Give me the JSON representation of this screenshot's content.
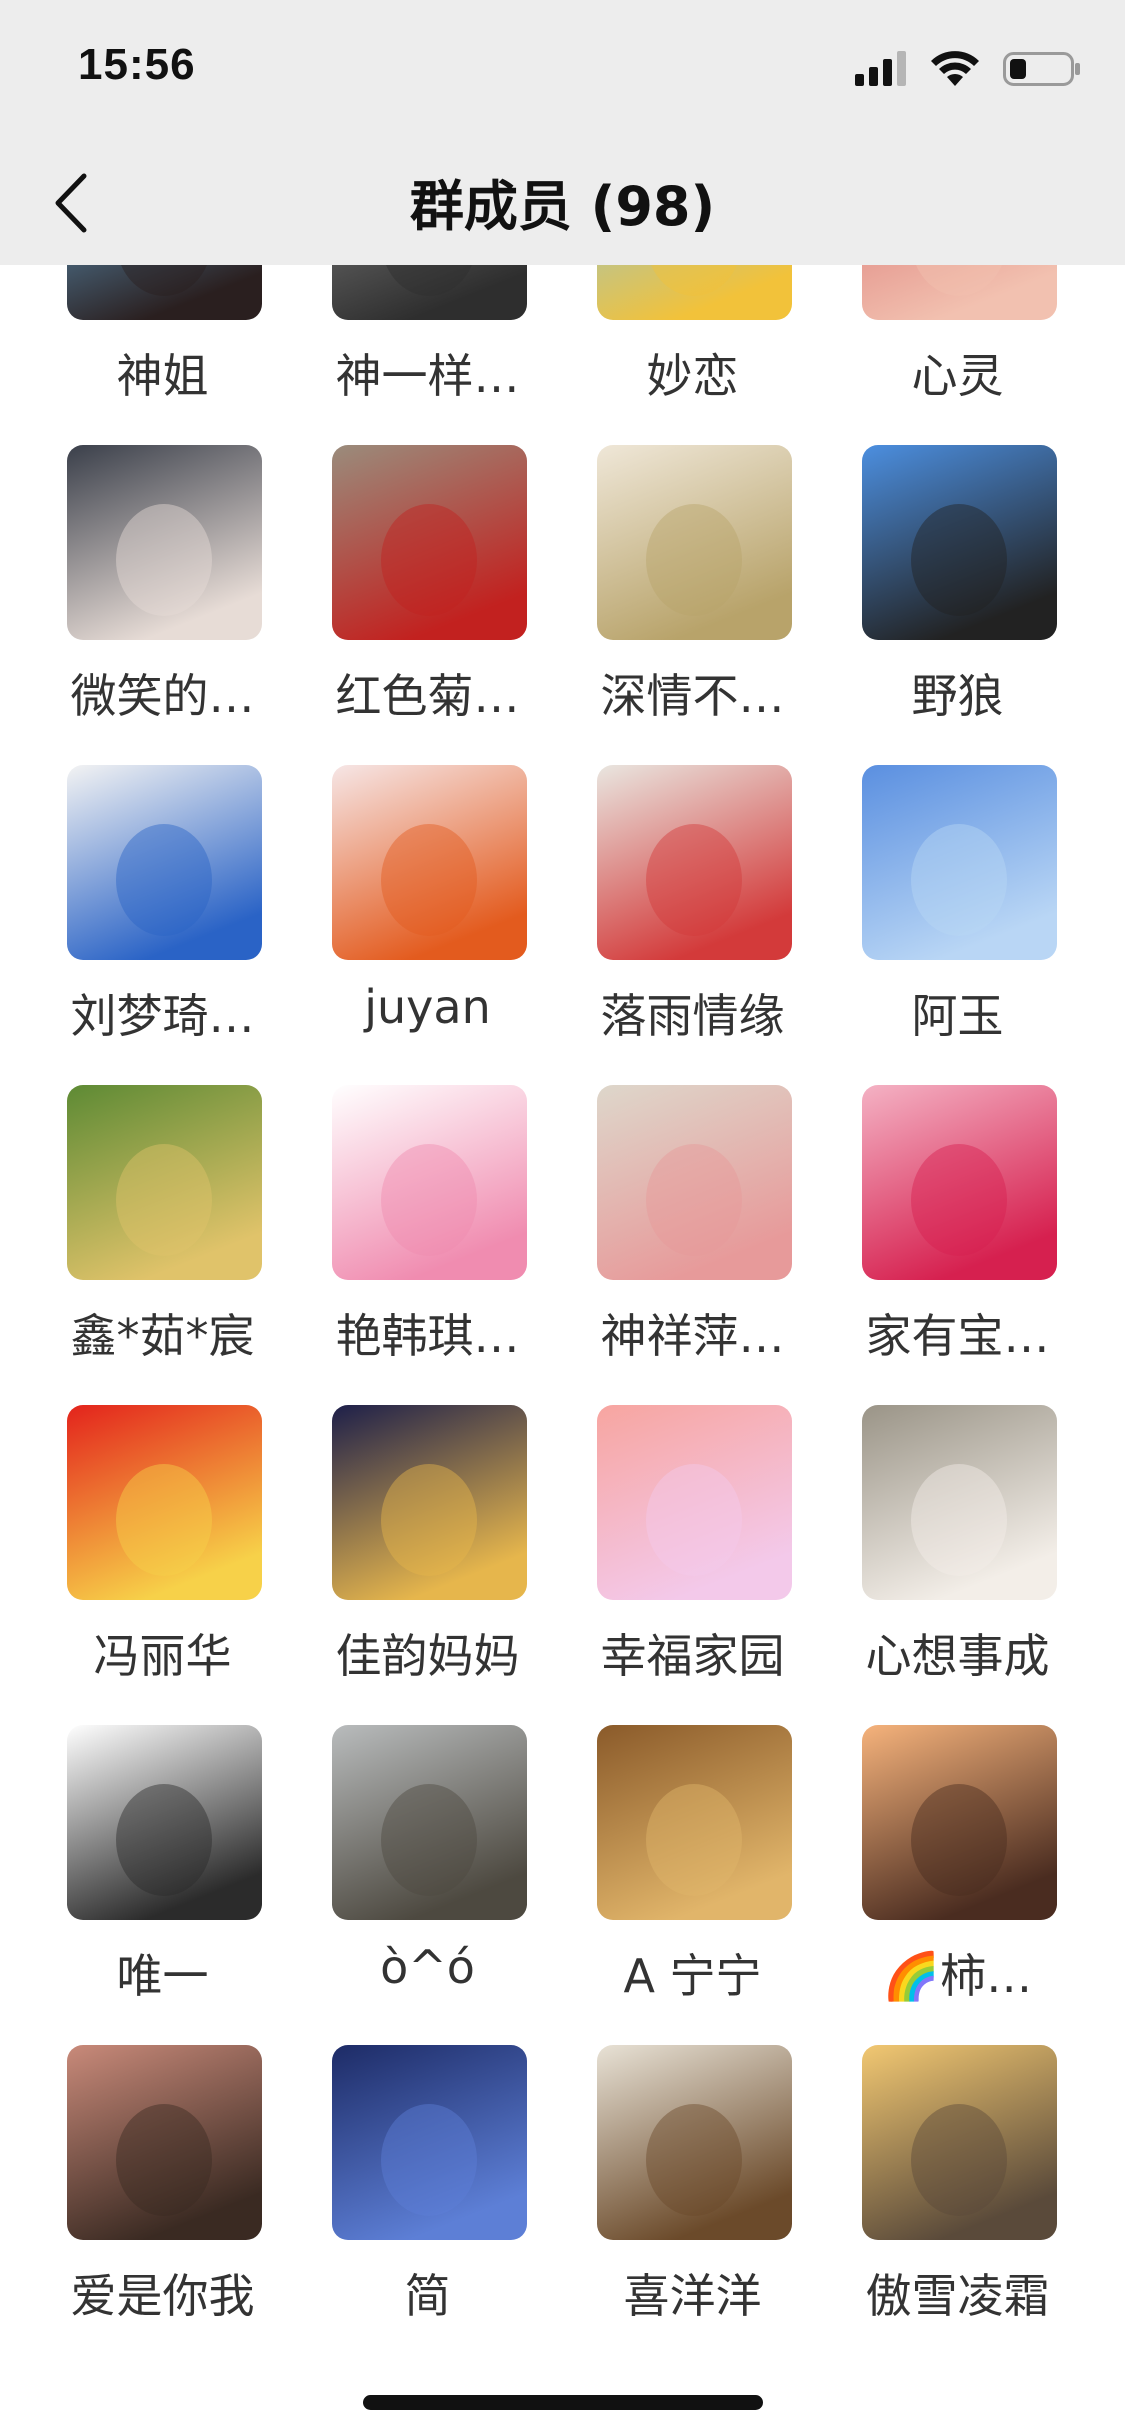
{
  "status_bar": {
    "time": "15:56"
  },
  "nav": {
    "title": "群成员 (98)",
    "back_icon": "chevron-left-icon"
  },
  "members": [
    {
      "name": "神姐",
      "avatar": "beads-photo",
      "colors": [
        "#6db6e6",
        "#2a1f1f"
      ]
    },
    {
      "name": "神一样…",
      "avatar": "car-selfie",
      "colors": [
        "#8c8c8c",
        "#2e2e2e"
      ]
    },
    {
      "name": "妙恋",
      "avatar": "sunflower-guitar",
      "colors": [
        "#7fc6ee",
        "#f2c23a"
      ]
    },
    {
      "name": "心灵",
      "avatar": "baby-photo",
      "colors": [
        "#d66a6a",
        "#f2c1b0"
      ]
    },
    {
      "name": "微笑的…",
      "avatar": "girl-portrait",
      "colors": [
        "#3a3f4a",
        "#e7dcd6"
      ]
    },
    {
      "name": "红色菊…",
      "avatar": "red-berries",
      "colors": [
        "#9a8c7c",
        "#c2211f"
      ]
    },
    {
      "name": "深情不…",
      "avatar": "dried-flowers",
      "colors": [
        "#efe7d8",
        "#b8a36a"
      ]
    },
    {
      "name": "野狼",
      "avatar": "pagoda",
      "colors": [
        "#4c8fe0",
        "#222222"
      ]
    },
    {
      "name": "刘梦琦…",
      "avatar": "family-photo",
      "colors": [
        "#f3f3f3",
        "#2a63c6"
      ]
    },
    {
      "name": "juyan",
      "avatar": "calligraphy",
      "colors": [
        "#f6e6e6",
        "#e35b1e"
      ]
    },
    {
      "name": "落雨情缘",
      "avatar": "girl-crown",
      "colors": [
        "#e9e6e0",
        "#d33a3a"
      ]
    },
    {
      "name": "阿玉",
      "avatar": "sky",
      "colors": [
        "#5a8fe0",
        "#b9d6f5"
      ]
    },
    {
      "name": "鑫*茹*宸",
      "avatar": "mushrooms",
      "colors": [
        "#5d8a34",
        "#e0c36a"
      ]
    },
    {
      "name": "艳韩琪…",
      "avatar": "lotus",
      "colors": [
        "#ffffff",
        "#f08cb0"
      ]
    },
    {
      "name": "神祥萍…",
      "avatar": "roses-calligraphy",
      "colors": [
        "#ded7cb",
        "#e79a9a"
      ]
    },
    {
      "name": "家有宝…",
      "avatar": "wedding",
      "colors": [
        "#f4b2c4",
        "#d6204f"
      ]
    },
    {
      "name": "冯丽华",
      "avatar": "child-flag",
      "colors": [
        "#e3231c",
        "#f7d149"
      ]
    },
    {
      "name": "佳韵妈妈",
      "avatar": "city-night",
      "colors": [
        "#1d1f4a",
        "#e6b64c"
      ]
    },
    {
      "name": "幸福家园",
      "avatar": "pink-tree",
      "colors": [
        "#f7a5a0",
        "#f3c9ea"
      ]
    },
    {
      "name": "心想事成",
      "avatar": "woman-dress",
      "colors": [
        "#9a9487",
        "#f3eee8"
      ]
    },
    {
      "name": "唯一",
      "avatar": "cartoon-family",
      "colors": [
        "#ffffff",
        "#2b2b2b"
      ]
    },
    {
      "name": "ò^ó",
      "avatar": "seashore",
      "colors": [
        "#b9bcbd",
        "#4d4940"
      ]
    },
    {
      "name": "A  宁宁",
      "avatar": "harp",
      "colors": [
        "#8a5a2a",
        "#e1b56a"
      ]
    },
    {
      "name": "🌈柿…",
      "avatar": "sunglasses-girl",
      "colors": [
        "#f6b37c",
        "#4a2c20"
      ]
    },
    {
      "name": "爱是你我",
      "avatar": "woman-face",
      "colors": [
        "#c98a7a",
        "#3a2a22"
      ]
    },
    {
      "name": "简",
      "avatar": "starry-sky",
      "colors": [
        "#1d2b66",
        "#5d7fd6"
      ]
    },
    {
      "name": "喜洋洋",
      "avatar": "calligraphy-char",
      "colors": [
        "#e8e2d6",
        "#6b4a2a"
      ]
    },
    {
      "name": "傲雪凌霜",
      "avatar": "sunset-mountains",
      "colors": [
        "#f2c872",
        "#5a4a3a"
      ]
    }
  ],
  "colors": {
    "header_bg": "#ededed",
    "text": "#333333",
    "title": "#111111"
  }
}
